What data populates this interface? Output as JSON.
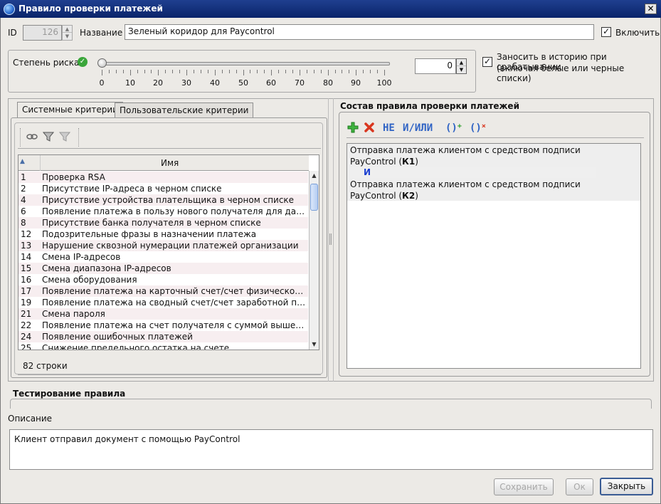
{
  "window": {
    "title": "Правило проверки платежей",
    "close_glyph": "✕"
  },
  "header": {
    "id_label": "ID",
    "id_value": "126",
    "name_label": "Название",
    "name_value": "Зеленый коридор для Paycontrol",
    "enable_label": "Включить",
    "enable_checked": true
  },
  "risk": {
    "label": "Степень риска",
    "status_icon": "check-circle-icon",
    "slider_value": 0,
    "ticks": [
      "0",
      "10",
      "20",
      "30",
      "40",
      "50",
      "60",
      "70",
      "80",
      "90",
      "100"
    ],
    "spinner_value": "0",
    "history_label_1": "Заносить в историю при срабатывании",
    "history_label_2": "(включая белые или черные списки)",
    "history_checked": true
  },
  "criteria": {
    "tabs": [
      {
        "label": "Системные критерии",
        "active": true
      },
      {
        "label": "Пользовательские критерии",
        "active": false
      }
    ],
    "toolbar_icons": [
      "view-icon",
      "filter-icon",
      "clear-filter-icon"
    ],
    "column_sort": "▲",
    "column_name": "Имя",
    "rows": [
      {
        "num": "1",
        "name": "Проверка RSA"
      },
      {
        "num": "2",
        "name": "Присутствие IP-адреса в черном списке"
      },
      {
        "num": "4",
        "name": "Присутствие устройства плательщика в черном списке"
      },
      {
        "num": "6",
        "name": "Появление платежа в пользу нового получателя для данного с..."
      },
      {
        "num": "8",
        "name": "Присутствие банка получателя в черном списке"
      },
      {
        "num": "12",
        "name": "Подозрительные фразы в назначении платежа"
      },
      {
        "num": "13",
        "name": "Нарушение сквозной нумерации платежей организации"
      },
      {
        "num": "14",
        "name": "Смена IP-адресов"
      },
      {
        "num": "15",
        "name": "Смена диапазона IP-адресов"
      },
      {
        "num": "16",
        "name": "Смена оборудования"
      },
      {
        "num": "17",
        "name": "Появление платежа на карточный счет/счет физического лица"
      },
      {
        "num": "19",
        "name": "Появление платежа на сводный счет/счет заработной платы"
      },
      {
        "num": "21",
        "name": "Смена пароля"
      },
      {
        "num": "22",
        "name": "Появление платежа на счет получателя с суммой выше преде..."
      },
      {
        "num": "24",
        "name": "Появление ошибочных платежей"
      },
      {
        "num": "25",
        "name": "Снижение предельного остатка на счете"
      }
    ],
    "row_count": "82 строки"
  },
  "composition": {
    "title": "Состав правила проверки платежей",
    "toolbar": {
      "add_icon": "plus-icon",
      "delete_icon": "cross-icon",
      "not_label": "НЕ",
      "andor_label": "И/ИЛИ",
      "group_add_label": "()",
      "group_remove_label": "()"
    },
    "items": {
      "c1_line1": "Отправка платежа клиентом с средством подписи",
      "c1_line2": "PayControl (",
      "c1_key": "К1",
      "c1_close": ")",
      "operator": "И",
      "c2_line1": "Отправка платежа клиентом с средством подписи",
      "c2_line2": "PayControl (",
      "c2_key": "К2",
      "c2_close": ")"
    }
  },
  "testing": {
    "title": "Тестирование правила"
  },
  "description": {
    "label": "Описание",
    "value": "Клиент отправил документ с помощью PayControl"
  },
  "buttons": {
    "save": "Сохранить",
    "ok": "Ок",
    "close": "Закрыть"
  }
}
